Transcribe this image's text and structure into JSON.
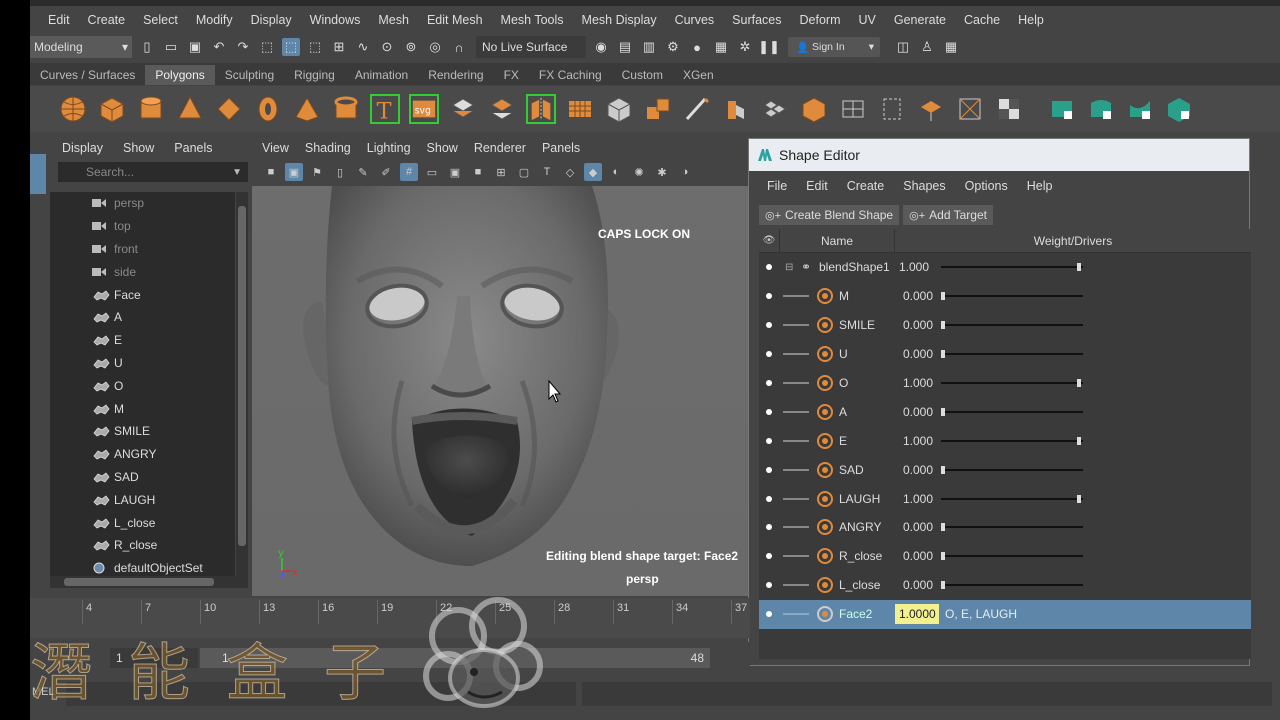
{
  "menubar": [
    "Edit",
    "Create",
    "Select",
    "Modify",
    "Display",
    "Windows",
    "Mesh",
    "Edit Mesh",
    "Mesh Tools",
    "Mesh Display",
    "Curves",
    "Surfaces",
    "Deform",
    "UV",
    "Generate",
    "Cache",
    "Help"
  ],
  "statusline": {
    "mode": "Modeling",
    "live_surface": "No Live Surface",
    "sign_in": "Sign In"
  },
  "shelf_tabs": [
    "Curves / Surfaces",
    "Polygons",
    "Sculpting",
    "Rigging",
    "Animation",
    "Rendering",
    "FX",
    "FX Caching",
    "Custom",
    "XGen"
  ],
  "shelf_active_tab": "Polygons",
  "outliner": {
    "menu": [
      "Display",
      "Show",
      "Panels"
    ],
    "search_placeholder": "Search...",
    "items": [
      {
        "label": "persp",
        "type": "camera",
        "dim": true
      },
      {
        "label": "top",
        "type": "camera",
        "dim": true
      },
      {
        "label": "front",
        "type": "camera",
        "dim": true
      },
      {
        "label": "side",
        "type": "camera",
        "dim": true
      },
      {
        "label": "Face",
        "type": "mesh",
        "dim": false
      },
      {
        "label": "A",
        "type": "mesh",
        "dim": false
      },
      {
        "label": "E",
        "type": "mesh",
        "dim": false
      },
      {
        "label": "U",
        "type": "mesh",
        "dim": false
      },
      {
        "label": "O",
        "type": "mesh",
        "dim": false
      },
      {
        "label": "M",
        "type": "mesh",
        "dim": false
      },
      {
        "label": "SMILE",
        "type": "mesh",
        "dim": false
      },
      {
        "label": "ANGRY",
        "type": "mesh",
        "dim": false
      },
      {
        "label": "SAD",
        "type": "mesh",
        "dim": false
      },
      {
        "label": "LAUGH",
        "type": "mesh",
        "dim": false
      },
      {
        "label": "L_close",
        "type": "mesh",
        "dim": false
      },
      {
        "label": "R_close",
        "type": "mesh",
        "dim": false
      },
      {
        "label": "defaultObjectSet",
        "type": "set",
        "dim": false
      }
    ]
  },
  "viewport": {
    "menu": [
      "View",
      "Shading",
      "Lighting",
      "Show",
      "Renderer",
      "Panels"
    ],
    "caps_lock": "CAPS LOCK ON",
    "editing_msg": "Editing blend shape target: Face2",
    "camera_name": "persp"
  },
  "shape_editor": {
    "title": "Shape Editor",
    "menu": [
      "File",
      "Edit",
      "Create",
      "Shapes",
      "Options",
      "Help"
    ],
    "create_blend_shape": "Create Blend Shape",
    "add_target": "Add Target",
    "col_name": "Name",
    "col_weight": "Weight/Drivers",
    "blend_shape": {
      "name": "blendShape1",
      "value": "1.000",
      "weight": 1.0
    },
    "targets": [
      {
        "name": "M",
        "value": "0.000",
        "weight": 0.0
      },
      {
        "name": "SMILE",
        "value": "0.000",
        "weight": 0.0
      },
      {
        "name": "U",
        "value": "0.000",
        "weight": 0.0
      },
      {
        "name": "O",
        "value": "1.000",
        "weight": 1.0
      },
      {
        "name": "A",
        "value": "0.000",
        "weight": 0.0
      },
      {
        "name": "E",
        "value": "1.000",
        "weight": 1.0
      },
      {
        "name": "SAD",
        "value": "0.000",
        "weight": 0.0
      },
      {
        "name": "LAUGH",
        "value": "1.000",
        "weight": 1.0
      },
      {
        "name": "ANGRY",
        "value": "0.000",
        "weight": 0.0
      },
      {
        "name": "R_close",
        "value": "0.000",
        "weight": 0.0
      },
      {
        "name": "L_close",
        "value": "0.000",
        "weight": 0.0
      }
    ],
    "combo_target": {
      "name": "Face2",
      "value": "1.0000",
      "drivers": "O, E, LAUGH"
    }
  },
  "timeline": {
    "ticks": [
      "4",
      "7",
      "10",
      "13",
      "16",
      "19",
      "22",
      "25",
      "28",
      "31",
      "34",
      "37"
    ],
    "range_start": "1",
    "range_slider_start": "1",
    "range_slider_end": "48"
  },
  "command_line": {
    "label": "MEL"
  },
  "watermark": {
    "text": "潛能盒子"
  },
  "colors": {
    "accent": "#5d86a8",
    "shelf_orange": "#e08a3c",
    "highlight_field": "#f3f090"
  }
}
